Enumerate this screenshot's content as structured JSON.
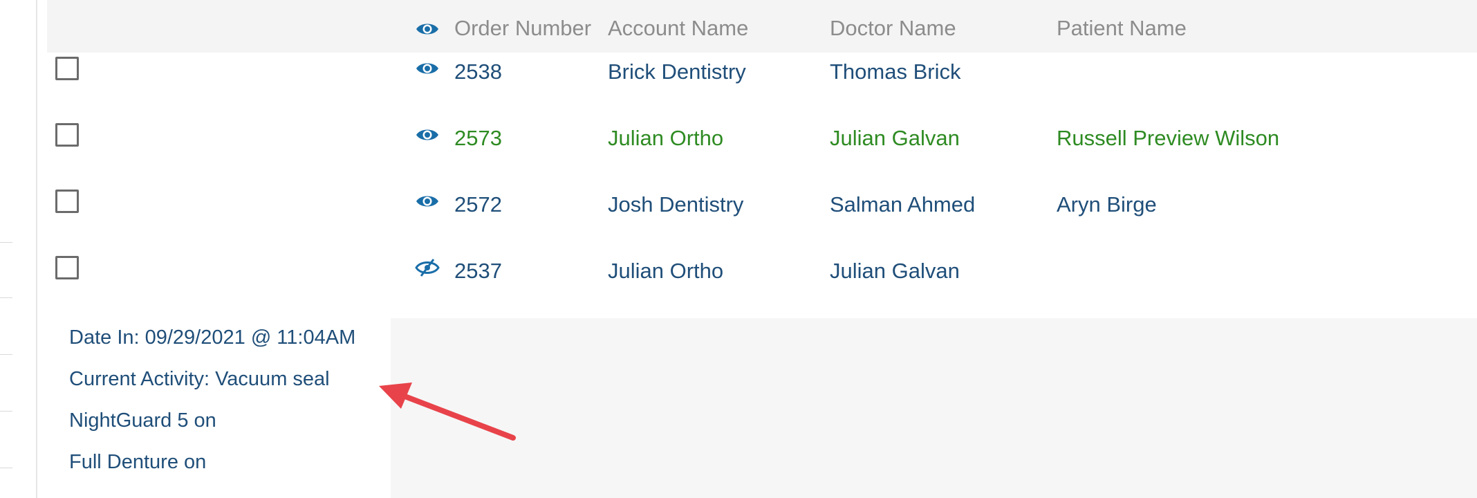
{
  "table": {
    "headers": {
      "order_number": "Order Number",
      "account_name": "Account Name",
      "doctor_name": "Doctor Name",
      "patient_name": "Patient Name"
    },
    "rows": [
      {
        "order_number": "2538",
        "account_name": "Brick Dentistry",
        "doctor_name": "Thomas Brick",
        "patient_name": "",
        "color": "blue",
        "icon": "eye-icon"
      },
      {
        "order_number": "2573",
        "account_name": "Julian Ortho",
        "doctor_name": "Julian Galvan",
        "patient_name": "Russell Preview Wilson",
        "color": "green",
        "icon": "eye-icon"
      },
      {
        "order_number": "2572",
        "account_name": "Josh Dentistry",
        "doctor_name": "Salman Ahmed",
        "patient_name": "Aryn Birge",
        "color": "blue",
        "icon": "eye-icon"
      },
      {
        "order_number": "2537",
        "account_name": "Julian Ortho",
        "doctor_name": "Julian Galvan",
        "patient_name": "",
        "color": "blue",
        "icon": "eye-slash-icon"
      }
    ]
  },
  "details": {
    "date_in": "Date In: 09/29/2021 @ 11:04AM",
    "current_activity": "Current Activity: Vacuum seal",
    "item1": "NightGuard 5 on",
    "item2": "Full Denture on"
  },
  "colors": {
    "link_blue": "#1f4e79",
    "link_green": "#2e8b22",
    "icon_blue": "#1a6ea8",
    "annotation_arrow": "#e8434a"
  }
}
